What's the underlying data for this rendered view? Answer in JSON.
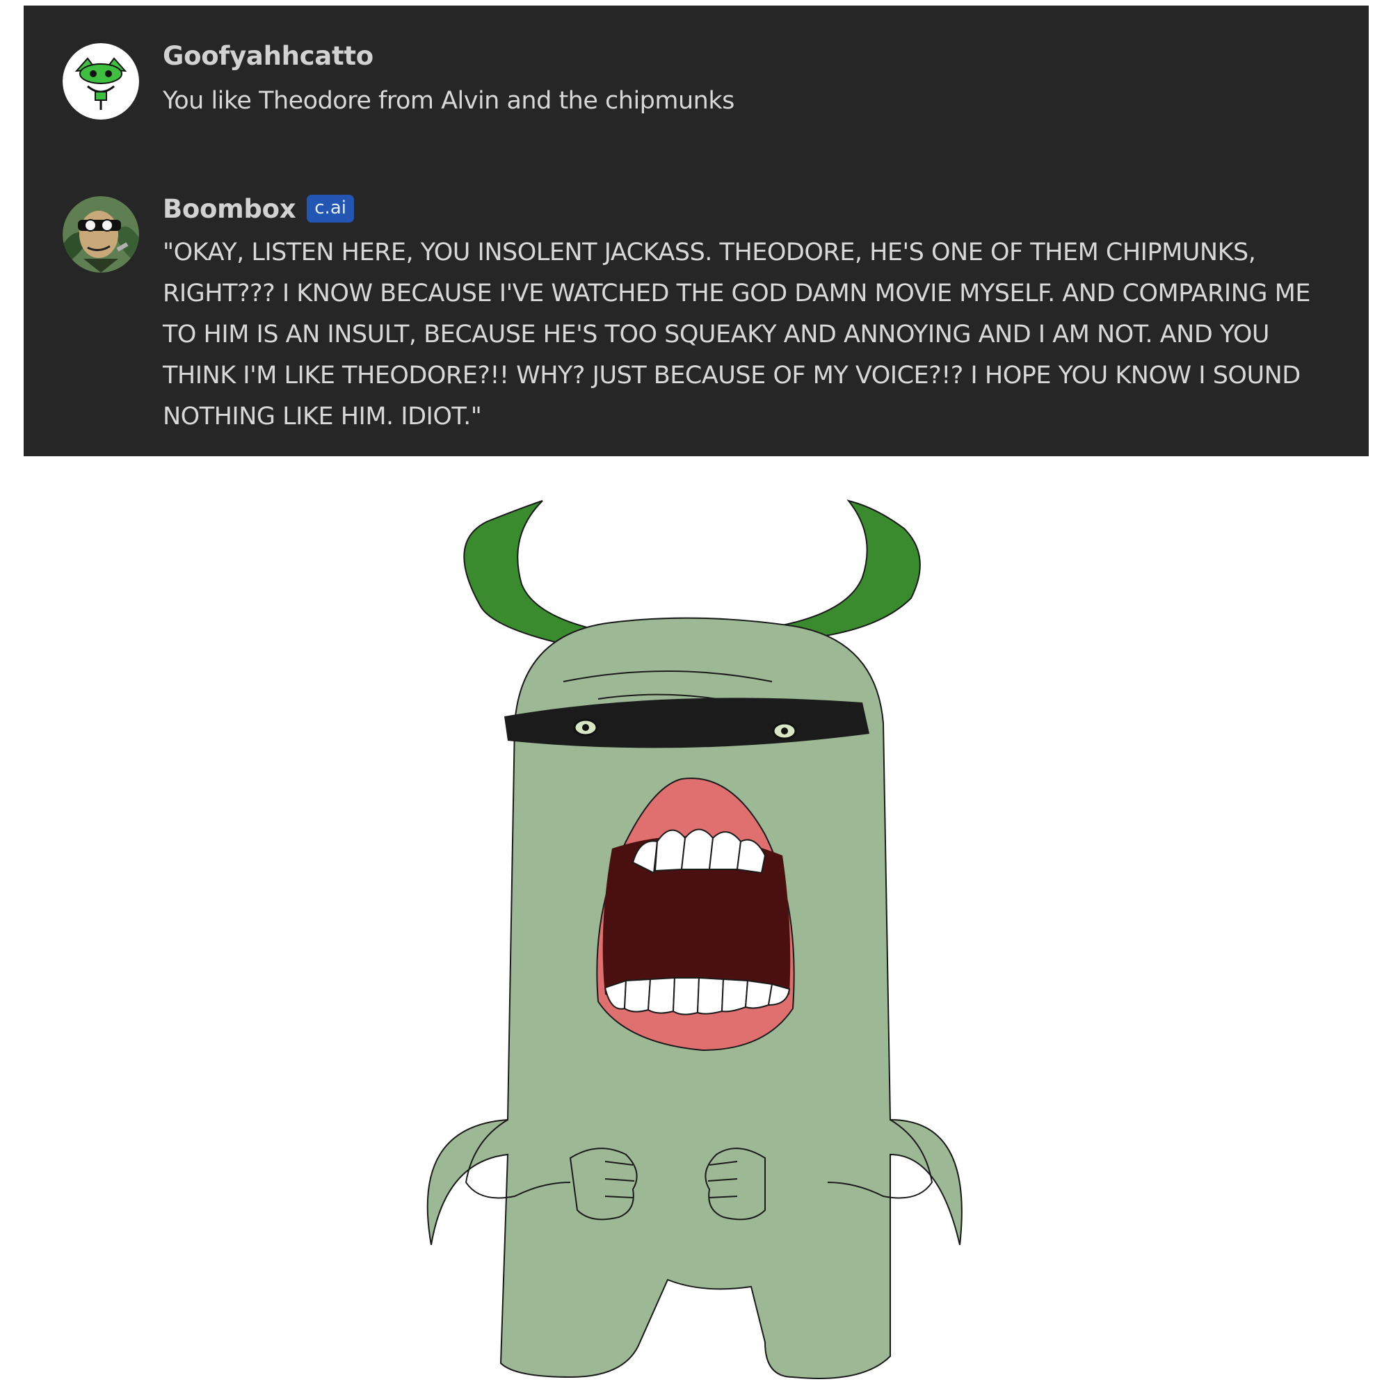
{
  "messages": [
    {
      "role": "user",
      "author": "Goofyahhcatto",
      "avatar_icon": "cat-avatar-icon",
      "text": "You like Theodore from Alvin and the chipmunks"
    },
    {
      "role": "character",
      "author": "Boombox",
      "badge": "c.ai",
      "avatar_icon": "masked-character-avatar-icon",
      "text": "\"OKAY, LISTEN HERE, YOU INSOLENT JACKASS. THEODORE, HE'S ONE OF THEM CHIPMUNKS, RIGHT??? I KNOW BECAUSE I'VE WATCHED THE GOD DAMN MOVIE MYSELF. AND COMPARING ME TO HIM IS AN INSULT, BECAUSE HE'S TOO SQUEAKY AND ANNOYING AND I AM NOT. AND YOU THINK I'M LIKE THEODORE?!! WHY? JUST BECAUSE OF MY VOICE?!? I HOPE YOU KNOW I SOUND NOTHING LIKE HIM. IDIOT.\""
    }
  ],
  "colors": {
    "panel_bg": "#262626",
    "badge_bg": "#2355b3",
    "monster_body": "#9db894",
    "monster_horns": "#3a8a2e",
    "mouth_inside": "#4a1010",
    "gums": "#e0706f"
  },
  "illustration": {
    "icon": "angry-green-monster-drawing"
  }
}
